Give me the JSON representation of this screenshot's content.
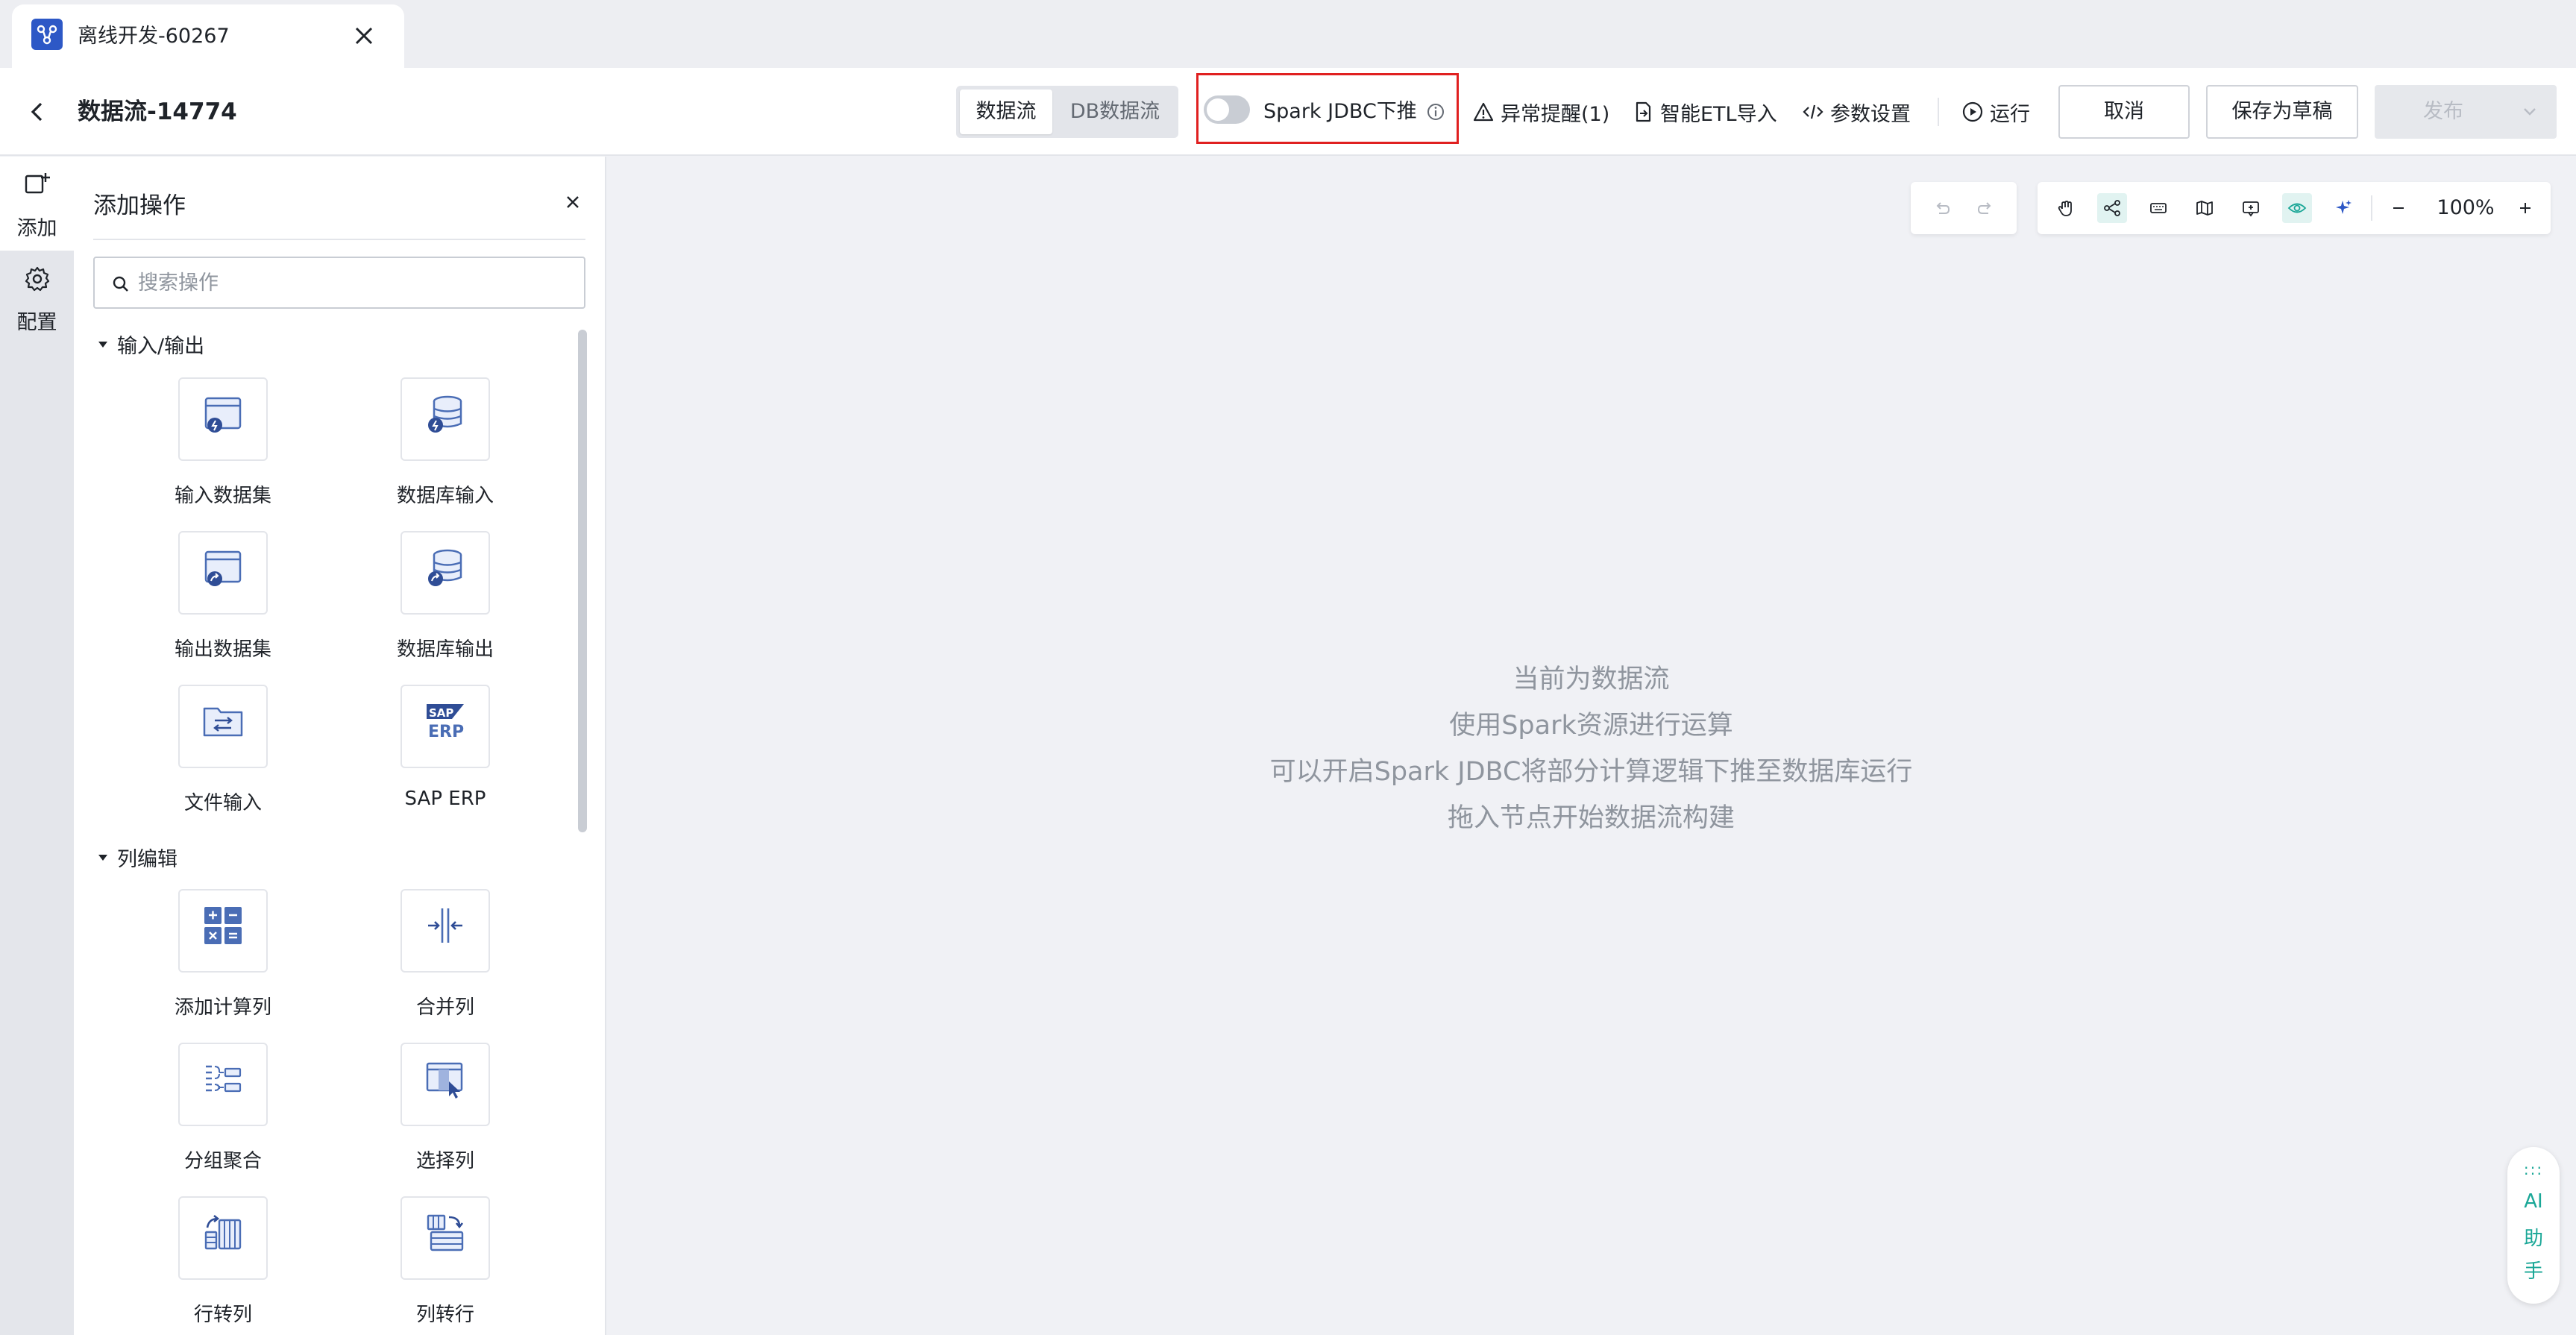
{
  "browser_tab": {
    "title": "离线开发-60267",
    "icon": "dataflow-icon"
  },
  "header": {
    "title": "数据流-14774",
    "mode_tabs": [
      {
        "label": "数据流",
        "active": true
      },
      {
        "label": "DB数据流",
        "active": false
      }
    ],
    "jdbc_toggle": {
      "label": "Spark JDBC下推",
      "on": false
    },
    "tools": [
      {
        "label": "异常提醒(1)",
        "icon": "warning-icon"
      },
      {
        "label": "智能ETL导入",
        "icon": "file-import-icon"
      },
      {
        "label": "参数设置",
        "icon": "code-icon"
      },
      {
        "label": "运行",
        "icon": "play-circle-icon"
      }
    ],
    "buttons": {
      "cancel": "取消",
      "save_draft": "保存为草稿",
      "publish": "发布"
    }
  },
  "rail": [
    {
      "label": "添加",
      "icon": "add-node-icon",
      "active": true
    },
    {
      "label": "配置",
      "icon": "gear-icon",
      "active": false
    }
  ],
  "panel": {
    "title": "添加操作",
    "search_placeholder": "搜索操作",
    "sections": [
      {
        "title": "输入/输出",
        "items": [
          {
            "label": "输入数据集",
            "icon": "input-dataset-icon"
          },
          {
            "label": "数据库输入",
            "icon": "database-input-icon"
          },
          {
            "label": "输出数据集",
            "icon": "output-dataset-icon"
          },
          {
            "label": "数据库输出",
            "icon": "database-output-icon"
          },
          {
            "label": "文件输入",
            "icon": "file-input-icon"
          },
          {
            "label": "SAP ERP",
            "icon": "sap-erp-icon"
          }
        ]
      },
      {
        "title": "列编辑",
        "items": [
          {
            "label": "添加计算列",
            "icon": "calculator-icon"
          },
          {
            "label": "合并列",
            "icon": "merge-columns-icon"
          },
          {
            "label": "分组聚合",
            "icon": "group-aggregate-icon"
          },
          {
            "label": "选择列",
            "icon": "select-columns-icon"
          },
          {
            "label": "行转列",
            "icon": "row-to-column-icon"
          },
          {
            "label": "列转行",
            "icon": "column-to-row-icon"
          }
        ]
      }
    ]
  },
  "canvas": {
    "zoom": "100%",
    "empty_lines": [
      "当前为数据流",
      "使用Spark资源进行运算",
      "可以开启Spark JDBC将部分计算逻辑下推至数据库运行",
      "拖入节点开始数据流构建"
    ],
    "controls": [
      "undo-icon",
      "redo-icon",
      "hand-icon",
      "connect-icon",
      "keyboard-icon",
      "map-icon",
      "comment-icon",
      "eye-icon",
      "sparkle-icon",
      "zoom-out-icon",
      "zoom-in-icon"
    ]
  },
  "ai_assistant": {
    "dots": ":::",
    "chars": [
      "AI",
      "助",
      "手"
    ]
  },
  "colors": {
    "accent": "#2d58c6",
    "teal": "#1aa797",
    "highlight_border": "#e02020"
  }
}
